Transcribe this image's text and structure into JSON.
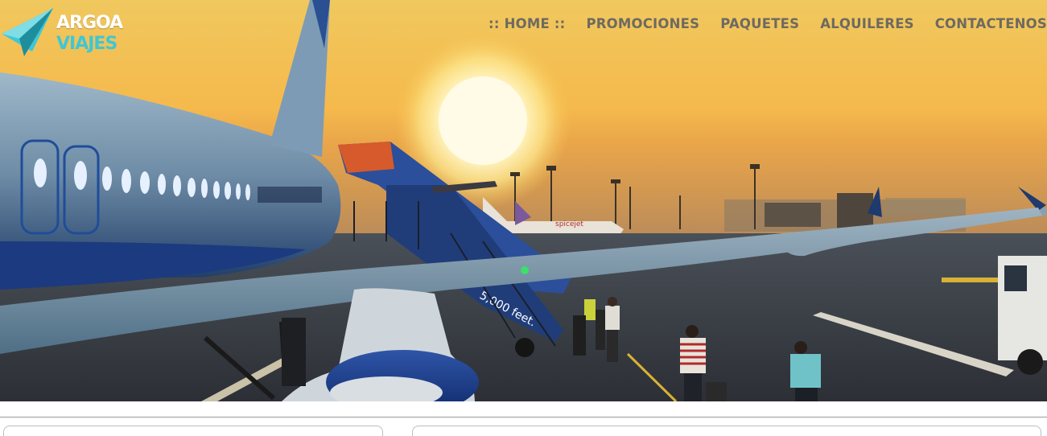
{
  "brand": {
    "name_line1": "ARGOA",
    "name_line2": "VIAJES"
  },
  "nav": {
    "items": [
      {
        "label": ":: HOME ::",
        "active": true
      },
      {
        "label": "PROMOCIONES"
      },
      {
        "label": "PAQUETES"
      },
      {
        "label": "ALQUILERES"
      },
      {
        "label": "CONTACTENOS"
      }
    ]
  },
  "hero": {
    "stair_text": "5,000 feet.",
    "tail_text": "spicejet"
  },
  "colors": {
    "accent": "#3ec7d6",
    "nav_text": "#6e6a60",
    "sky_top": "#f2c35a",
    "sky_bottom": "#f7b64a"
  }
}
